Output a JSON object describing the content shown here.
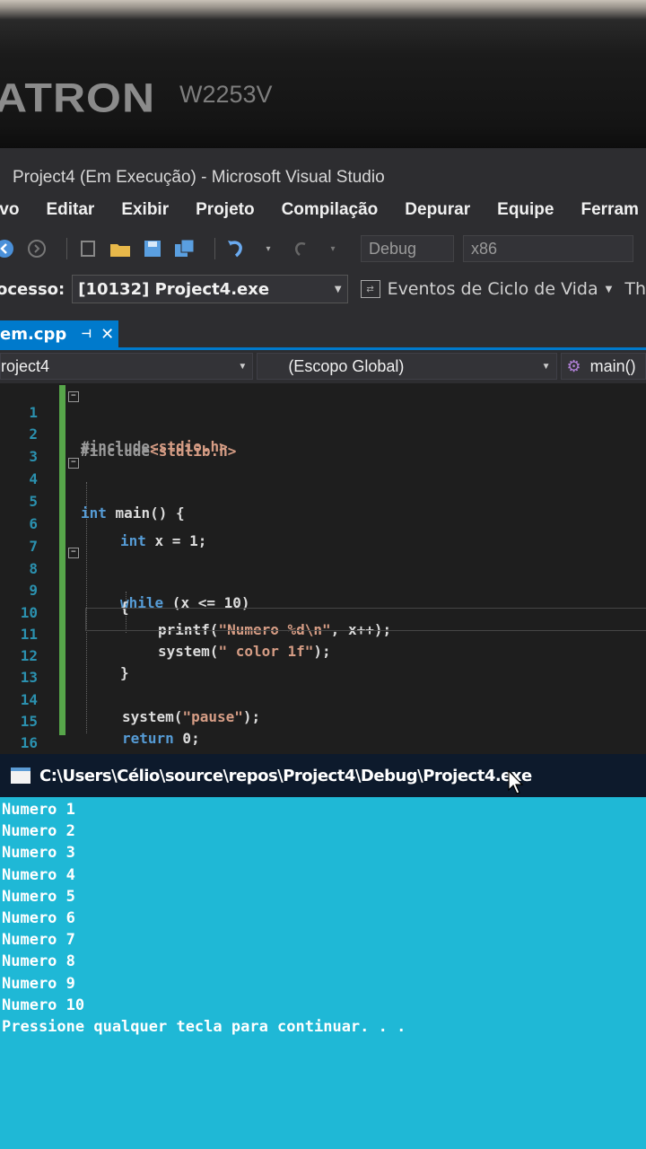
{
  "monitor": {
    "brand": "ATRON",
    "model": "W2253V"
  },
  "window": {
    "title": "Project4 (Em Execução) - Microsoft Visual Studio"
  },
  "menu": [
    "ivo",
    "Editar",
    "Exibir",
    "Projeto",
    "Compilação",
    "Depurar",
    "Equipe",
    "Ferram"
  ],
  "toolbar": {
    "config": "Debug",
    "platform": "x86"
  },
  "process": {
    "label": "ocesso:",
    "value": "[10132] Project4.exe",
    "events_label": "Eventos de Ciclo de Vida",
    "thread_label": "Th"
  },
  "tab": {
    "name": "em.cpp"
  },
  "nav": {
    "project": "roject4",
    "scope": "(Escopo Global)",
    "member": "main()"
  },
  "code": {
    "line_numbers": [
      "1",
      "2",
      "3",
      "4",
      "5",
      "6",
      "7",
      "8",
      "9",
      "10",
      "11",
      "12",
      "13",
      "14",
      "15",
      "16"
    ],
    "l1_pre": "#include",
    "l1_str": "<stdio.h>",
    "l2_pre": "#include",
    "l2_str": "<stdlib.h>",
    "l4_kw": "int",
    "l4_rest": " main() {",
    "l6_kw": "int",
    "l6_rest": " x = 1;",
    "l8_kw": "while",
    "l8_rest": " (x <= 10)",
    "l9": "{",
    "l10_a": "printf(",
    "l10_str": "\"Numero %d\\n\"",
    "l10_b": ", x++);",
    "l11_a": "system(",
    "l11_str": "\" color 1f\"",
    "l11_b": ");",
    "l12": "}",
    "l14_a": "system(",
    "l14_str": "\"pause\"",
    "l14_b": ");",
    "l15_kw": "return",
    "l15_rest": " 0;",
    "l16": "}"
  },
  "console": {
    "title": "C:\\Users\\Célio\\source\\repos\\Project4\\Debug\\Project4.exe",
    "lines": [
      "Numero 1",
      "Numero 2",
      "Numero 3",
      "Numero 4",
      "Numero 5",
      "Numero 6",
      "Numero 7",
      "Numero 8",
      "Numero 9",
      "Numero 10",
      "Pressione qualquer tecla para continuar. . ."
    ],
    "background": "#1fb8d6"
  }
}
